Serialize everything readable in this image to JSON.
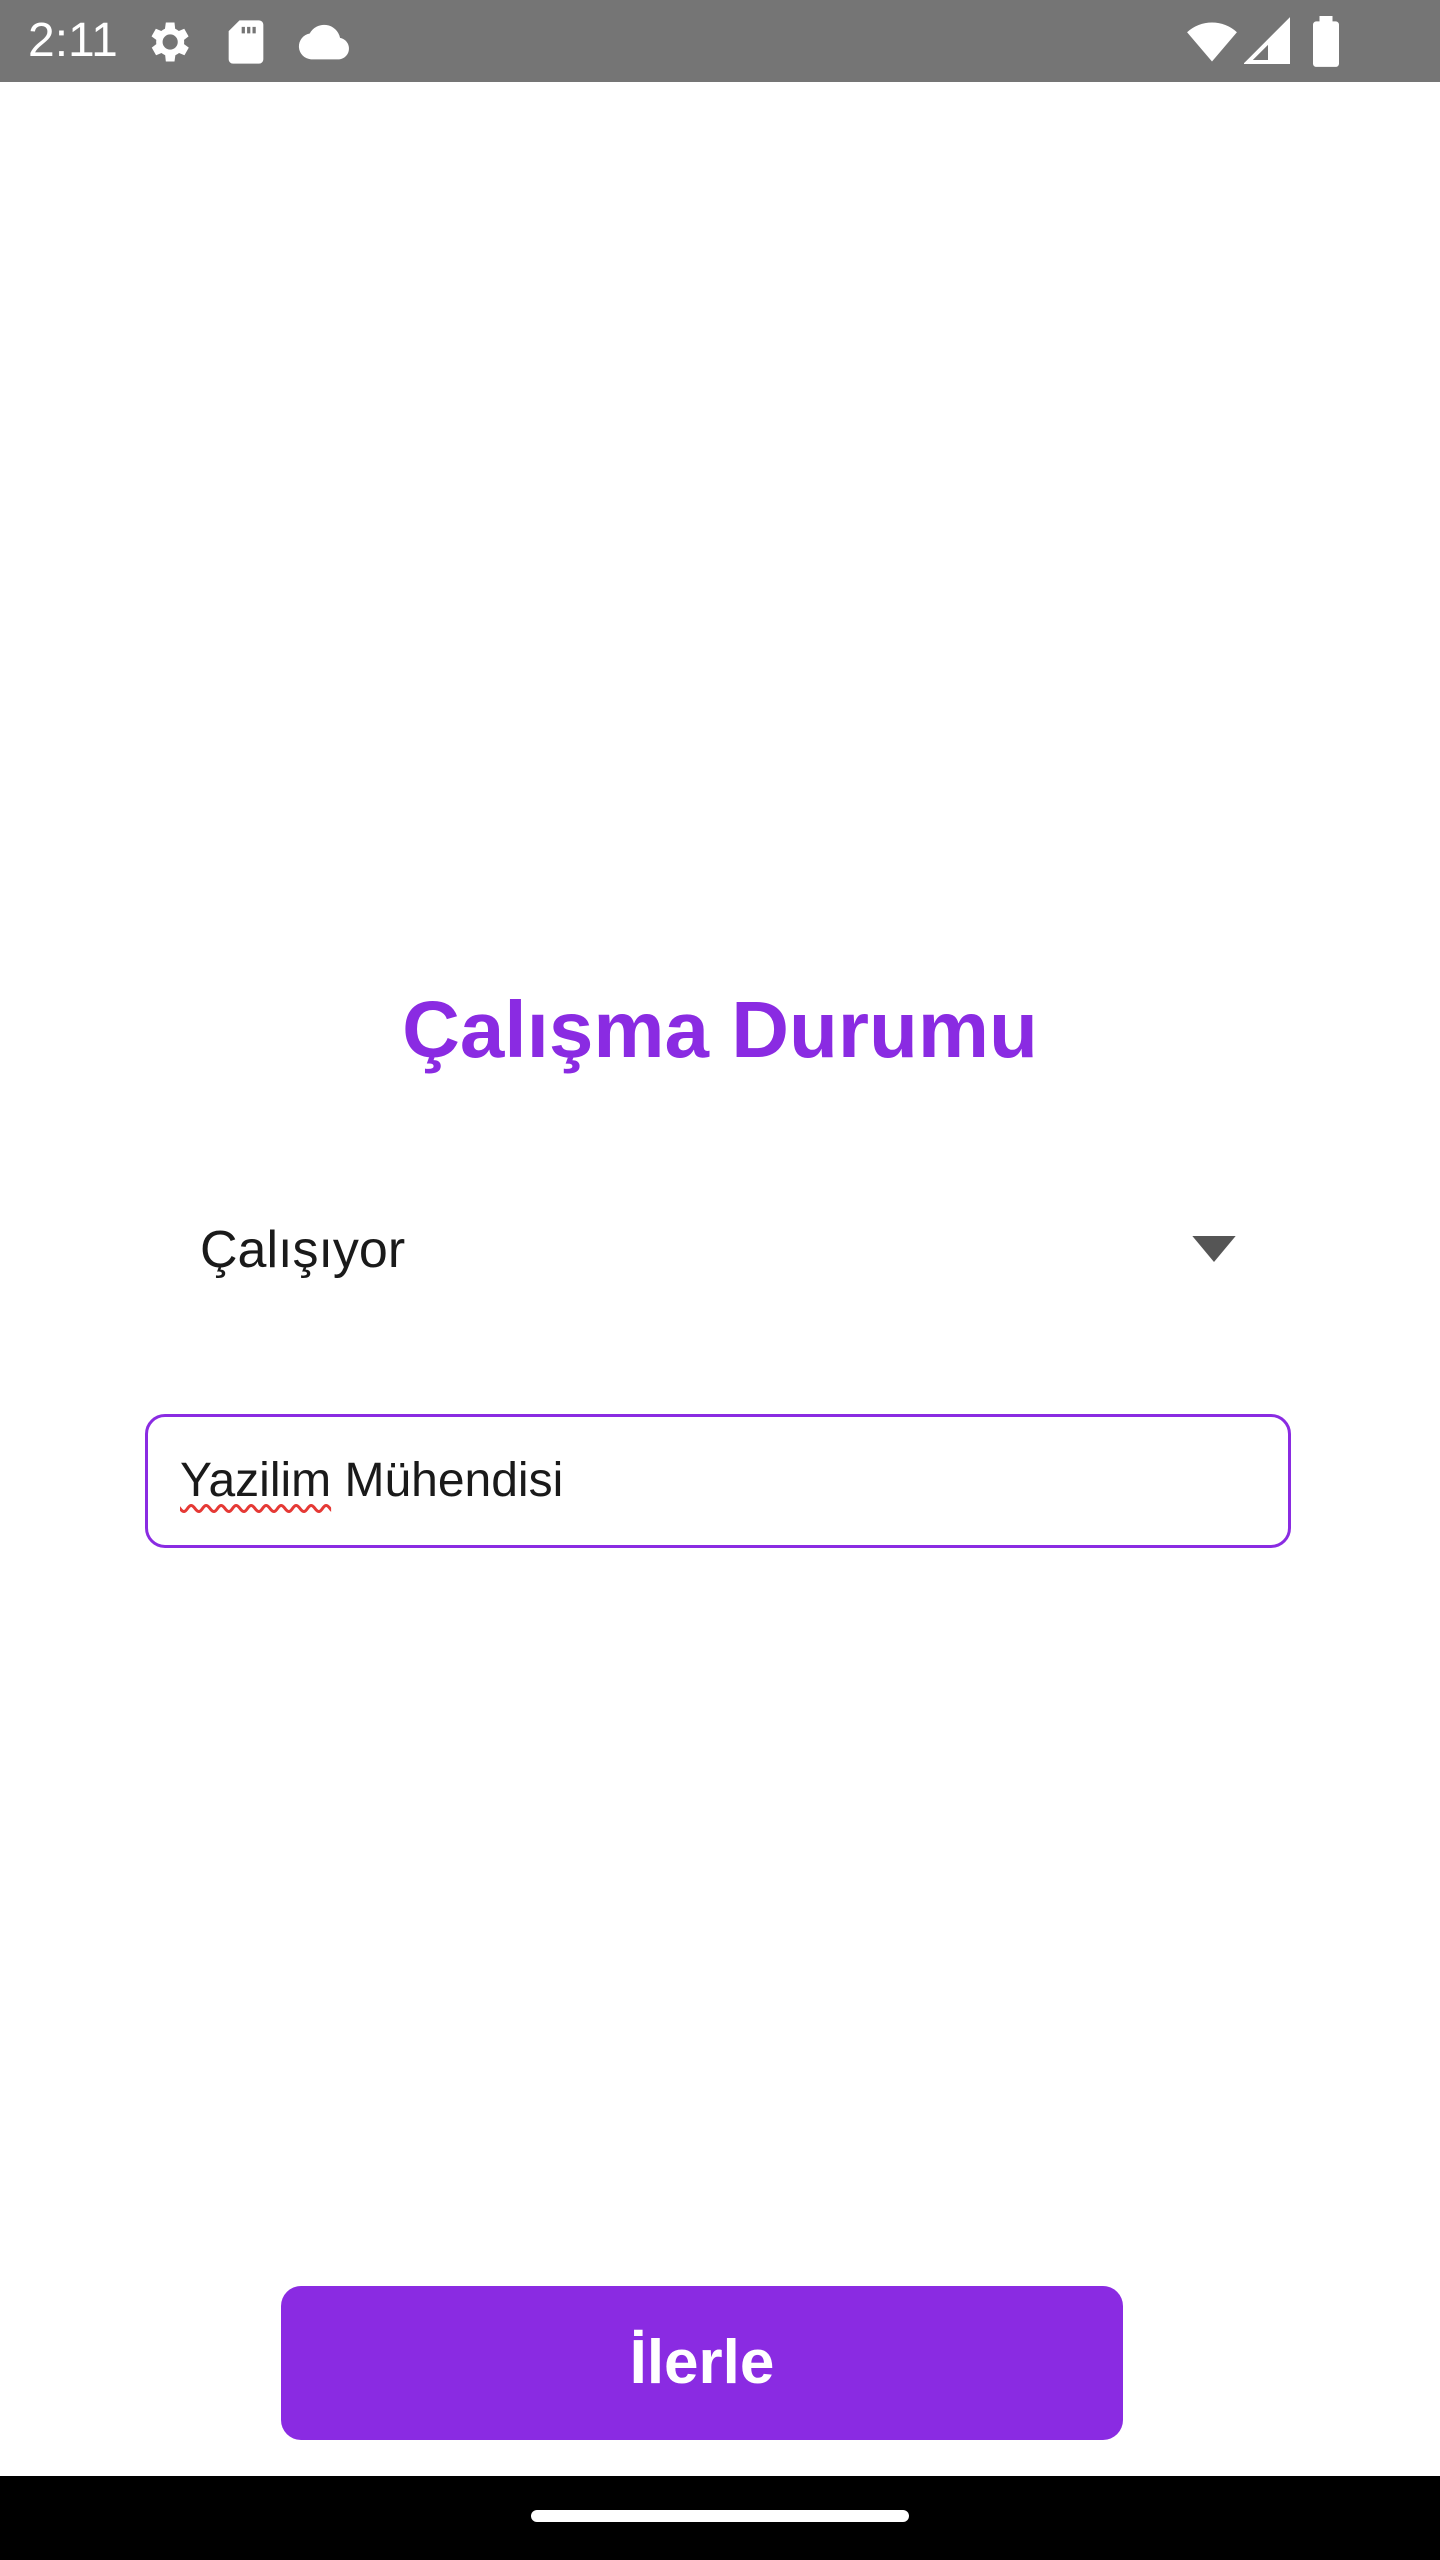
{
  "status_bar": {
    "time": "2:11",
    "left_icons": [
      "settings-icon",
      "sd-card-icon",
      "cloud-icon"
    ],
    "right_icons": [
      "wifi-icon",
      "signal-icon",
      "battery-icon"
    ],
    "background": "#757575"
  },
  "screen": {
    "title": "Çalışma Durumu",
    "dropdown": {
      "selected_value": "Çalışıyor"
    },
    "job_field": {
      "value_misspelled": "Yazilim",
      "value_rest": " Mühendisi"
    },
    "submit_label": "İlerle"
  },
  "colors": {
    "accent": "#8A2BE2",
    "spellcheck": "#e53935"
  }
}
